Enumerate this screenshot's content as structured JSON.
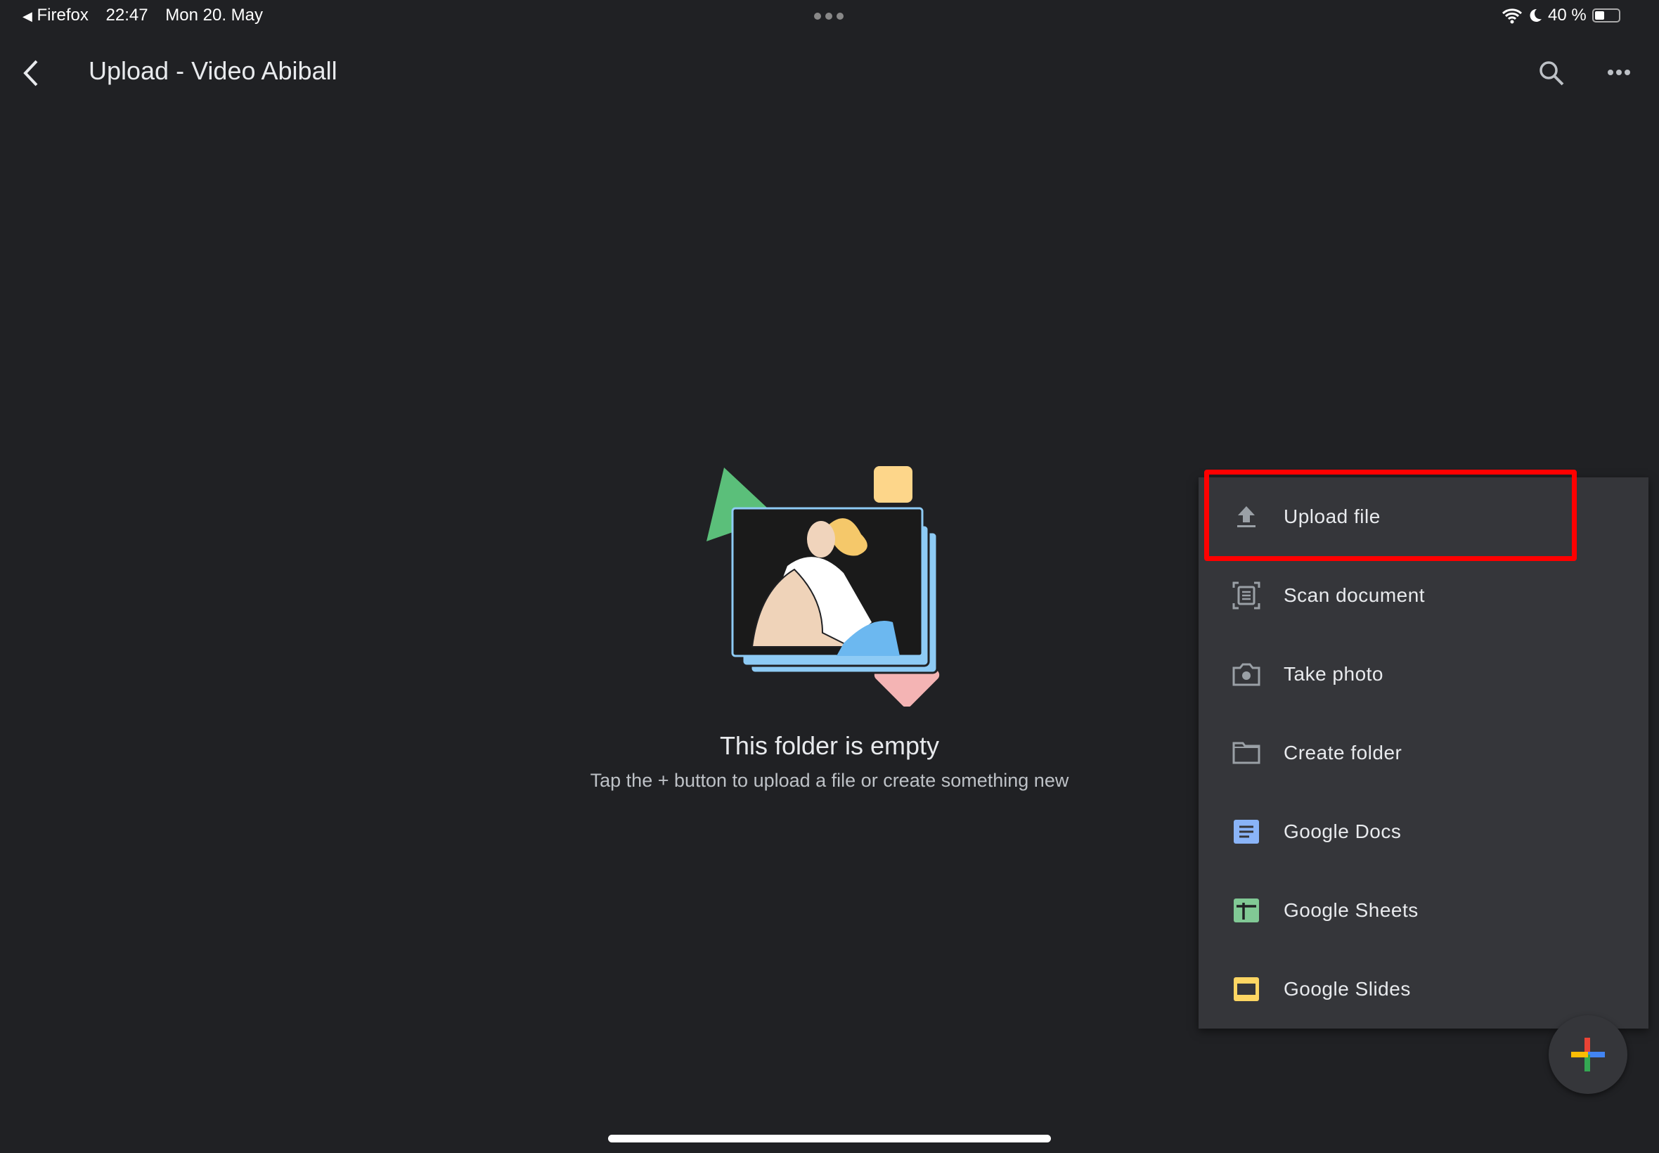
{
  "status_bar": {
    "back_app": "Firefox",
    "time": "22:47",
    "date": "Mon 20. May",
    "battery": "40 %",
    "battery_level": 0.4
  },
  "header": {
    "title": "Upload - Video Abiball",
    "back_icon": "chevron-left-icon",
    "search_icon": "search-icon",
    "more_icon": "more-horizontal-icon"
  },
  "empty_state": {
    "title": "This folder is empty",
    "subtitle": "Tap the + button to upload a file or create something new"
  },
  "menu": {
    "items": [
      {
        "label": "Upload file",
        "icon": "upload-icon"
      },
      {
        "label": "Scan document",
        "icon": "scan-document-icon"
      },
      {
        "label": "Take photo",
        "icon": "camera-icon"
      },
      {
        "label": "Create folder",
        "icon": "folder-icon"
      },
      {
        "label": "Google Docs",
        "icon": "google-docs-icon",
        "color": "#8ab4f8"
      },
      {
        "label": "Google Sheets",
        "icon": "google-sheets-icon",
        "color": "#81c995"
      },
      {
        "label": "Google Slides",
        "icon": "google-slides-icon",
        "color": "#fdd663"
      }
    ]
  },
  "highlight_color": "#ff0000",
  "fab": {
    "icon": "plus-icon"
  }
}
